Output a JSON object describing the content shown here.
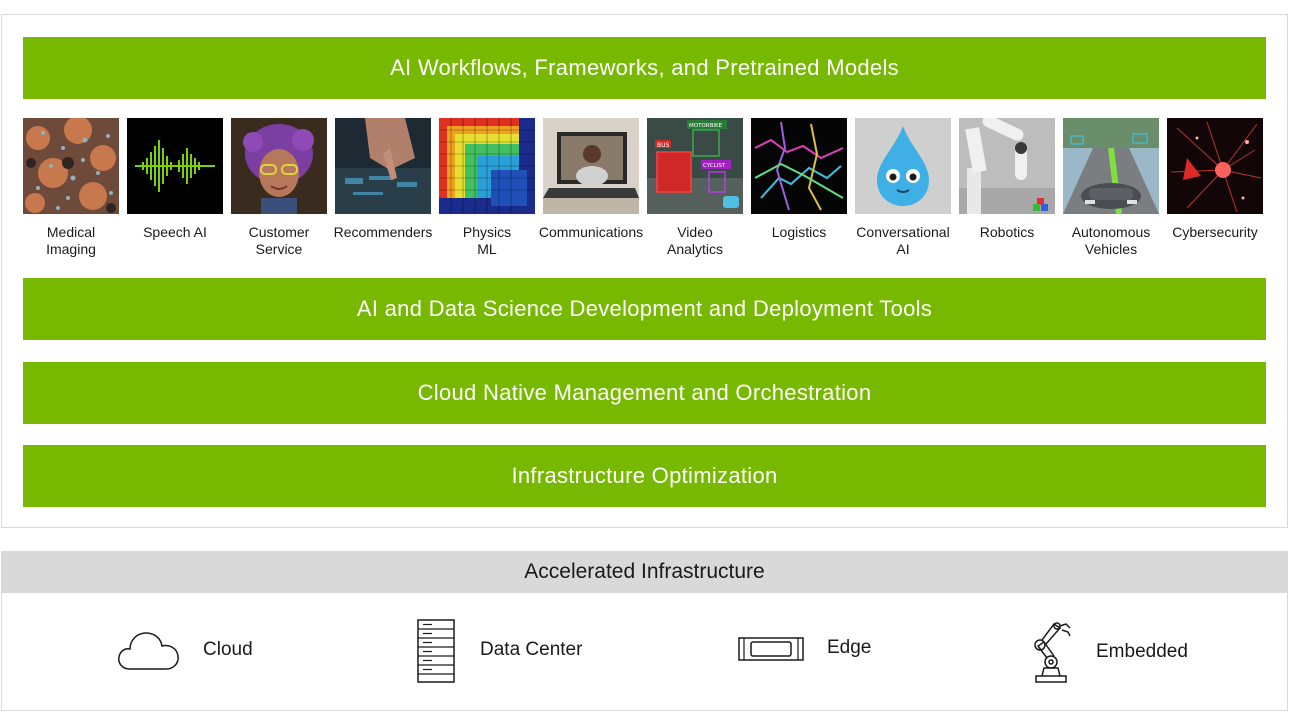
{
  "stack": {
    "top_bar": "AI Workflows, Frameworks, and Pretrained Models",
    "use_cases": [
      {
        "label": "Medical\nImaging",
        "icon": "medical-imaging-thumbnail"
      },
      {
        "label": "Speech AI",
        "icon": "speech-waveform-thumbnail"
      },
      {
        "label": "Customer\nService",
        "icon": "avatar-thumbnail"
      },
      {
        "label": "Recommenders",
        "icon": "touchscreen-thumbnail"
      },
      {
        "label": "Physics\nML",
        "icon": "heatmap-thumbnail"
      },
      {
        "label": "Communications",
        "icon": "video-call-thumbnail"
      },
      {
        "label": "Video\nAnalytics",
        "icon": "street-detection-thumbnail",
        "overlay_tags": [
          "MOTORBIKE",
          "BUS",
          "CYCLIST"
        ]
      },
      {
        "label": "Logistics",
        "icon": "route-map-thumbnail"
      },
      {
        "label": "Conversational\nAI",
        "icon": "water-drop-character-thumbnail"
      },
      {
        "label": "Robotics",
        "icon": "robot-arm-thumbnail"
      },
      {
        "label": "Autonomous\nVehicles",
        "icon": "car-road-thumbnail"
      },
      {
        "label": "Cybersecurity",
        "icon": "network-burst-thumbnail"
      }
    ],
    "middle_bars": [
      "AI and Data Science Development and Deployment Tools",
      "Cloud Native Management and Orchestration",
      "Infrastructure Optimization"
    ]
  },
  "infrastructure": {
    "title": "Accelerated Infrastructure",
    "items": [
      {
        "label": "Cloud",
        "icon": "cloud-icon"
      },
      {
        "label": "Data Center",
        "icon": "server-rack-icon"
      },
      {
        "label": "Edge",
        "icon": "edge-device-icon"
      },
      {
        "label": "Embedded",
        "icon": "robotic-arm-icon"
      }
    ]
  },
  "colors": {
    "accent_green": "#76b900",
    "header_gray": "#d9d9d9",
    "border_gray": "#d8d8d8"
  }
}
